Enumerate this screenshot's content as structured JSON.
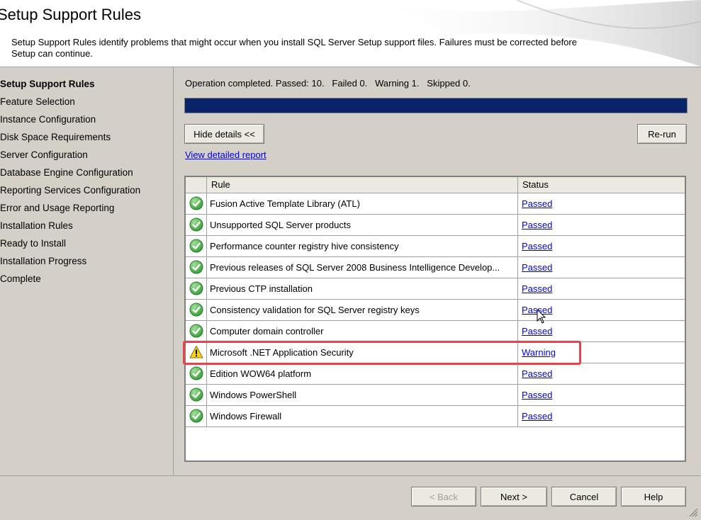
{
  "header": {
    "title": "Setup Support Rules",
    "description": "Setup Support Rules identify problems that might occur when you install SQL Server Setup support files. Failures must be corrected before Setup can continue."
  },
  "sidebar": {
    "items": [
      {
        "label": "Setup Support Rules",
        "current": true
      },
      {
        "label": "Feature Selection"
      },
      {
        "label": "Instance Configuration"
      },
      {
        "label": "Disk Space Requirements"
      },
      {
        "label": "Server Configuration"
      },
      {
        "label": "Database Engine Configuration"
      },
      {
        "label": "Reporting Services Configuration"
      },
      {
        "label": "Error and Usage Reporting"
      },
      {
        "label": "Installation Rules"
      },
      {
        "label": "Ready to Install"
      },
      {
        "label": "Installation Progress"
      },
      {
        "label": "Complete"
      }
    ]
  },
  "main": {
    "status_text": "Operation completed. Passed: 10.   Failed 0.   Warning 1.   Skipped 0.",
    "progress": 1.0,
    "hide_details_label": "Hide details <<",
    "rerun_label": "Re-run",
    "report_link": "View detailed report",
    "columns": {
      "rule": "Rule",
      "status": "Status"
    },
    "rows": [
      {
        "rule": "Fusion Active Template Library (ATL)",
        "status": "Passed",
        "icon": "check-circle-icon"
      },
      {
        "rule": "Unsupported SQL Server products",
        "status": "Passed",
        "icon": "check-circle-icon"
      },
      {
        "rule": "Performance counter registry hive consistency",
        "status": "Passed",
        "icon": "check-circle-icon"
      },
      {
        "rule": "Previous releases of SQL Server 2008 Business Intelligence Develop...",
        "status": "Passed",
        "icon": "check-circle-icon"
      },
      {
        "rule": "Previous CTP installation",
        "status": "Passed",
        "icon": "check-circle-icon"
      },
      {
        "rule": "Consistency validation for SQL Server registry keys",
        "status": "Passed",
        "icon": "check-circle-icon"
      },
      {
        "rule": "Computer domain controller",
        "status": "Passed",
        "icon": "check-circle-icon"
      },
      {
        "rule": "Microsoft .NET Application Security",
        "status": "Warning",
        "icon": "warning-triangle-icon"
      },
      {
        "rule": "Edition WOW64 platform",
        "status": "Passed",
        "icon": "check-circle-icon"
      },
      {
        "rule": "Windows PowerShell",
        "status": "Passed",
        "icon": "check-circle-icon"
      },
      {
        "rule": "Windows Firewall",
        "status": "Passed",
        "icon": "check-circle-icon"
      }
    ]
  },
  "footer": {
    "back_label": "< Back",
    "next_label": "Next >",
    "cancel_label": "Cancel",
    "help_label": "Help"
  },
  "colors": {
    "progress_fill": "#0a246a",
    "highlight_border": "#e8424b",
    "link": "#0000ee"
  }
}
